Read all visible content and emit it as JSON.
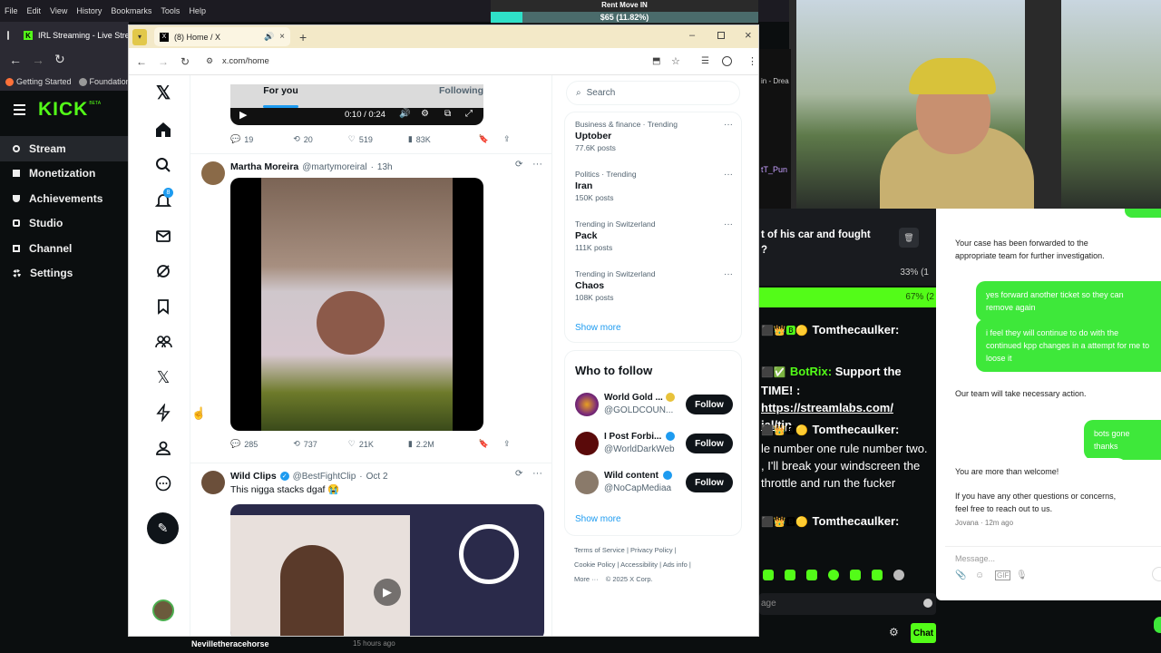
{
  "outer_browser": {
    "menu": [
      "File",
      "Edit",
      "View",
      "History",
      "Bookmarks",
      "Tools",
      "Help"
    ],
    "tab_title": "IRL Streaming - Live Stre",
    "bookmarks": [
      "Getting Started",
      "Foundation"
    ]
  },
  "overlay": {
    "title": "Rent Move IN",
    "amount": "$65 (11.82%)"
  },
  "kick": {
    "logo": "KICK",
    "beta": "BETA",
    "nav": [
      {
        "label": "Stream",
        "icon": "stream-icon"
      },
      {
        "label": "Monetization",
        "icon": "monetization-icon"
      },
      {
        "label": "Achievements",
        "icon": "trophy-icon"
      },
      {
        "label": "Studio",
        "icon": "studio-icon"
      },
      {
        "label": "Channel",
        "icon": "channel-icon"
      },
      {
        "label": "Settings",
        "icon": "gear-icon"
      }
    ]
  },
  "x_window": {
    "tab_title": "(8) Home / X",
    "url": "x.com/home",
    "feed_tabs": {
      "for_you": "For you",
      "following": "Following"
    },
    "video_time": "0:10 / 0:24",
    "search_placeholder": "Search",
    "notification_count": "8",
    "tweets": [
      {
        "replies": "19",
        "retweets": "20",
        "likes": "519",
        "views": "83K"
      },
      {
        "name": "Martha Moreira",
        "handle": "@martymoreiral",
        "time": "13h",
        "replies": "285",
        "retweets": "737",
        "likes": "21K",
        "views": "2.2M"
      },
      {
        "name": "Wild Clips",
        "handle": "@BestFightClip",
        "time": "Oct 2",
        "text": "This nigga stacks dgaf 😭"
      }
    ],
    "trends": [
      {
        "context": "Business & finance · Trending",
        "title": "Uptober",
        "posts": "77.6K posts"
      },
      {
        "context": "Politics · Trending",
        "title": "Iran",
        "posts": "150K posts"
      },
      {
        "context": "Trending in Switzerland",
        "title": "Pack",
        "posts": "111K posts"
      },
      {
        "context": "Trending in Switzerland",
        "title": "Chaos",
        "posts": "108K posts"
      }
    ],
    "show_more": "Show more",
    "who_to_follow_title": "Who to follow",
    "follow_suggestions": [
      {
        "name": "World Gold ...",
        "handle": "@GOLDCOUN..."
      },
      {
        "name": "I Post Forbi...",
        "handle": "@WorldDarkWeb"
      },
      {
        "name": "Wild content",
        "handle": "@NoCapMediaa"
      }
    ],
    "follow_label": "Follow",
    "footer": [
      "Terms of Service",
      "Privacy Policy",
      "Cookie Policy",
      "Accessibility",
      "Ads info",
      "More ···",
      "© 2025 X Corp."
    ],
    "bottom_strip_name": "Nevilletheracehorse",
    "bottom_strip_time": "15 hours ago"
  },
  "chat": {
    "partial_top": "t of his car and fought",
    "partial_top2": "?",
    "poll_a": "33% (1",
    "poll_b": "67% (2",
    "messages": [
      {
        "user": "Tomthecaulker:",
        "text": ""
      },
      {
        "user": "BotRix:",
        "text": " Support the TIME! : ",
        "link": "https://streamlabs.com/",
        "link2": "ial/tip"
      },
      {
        "user": "Tomthecaulker:",
        "text": "le number one rule number two. , I'll break your windscreen the throttle and run the fucker"
      },
      {
        "user": "Tomthecaulker:",
        "text": ""
      }
    ],
    "input_placeholder": "age",
    "chat_button": "Chat"
  },
  "sms": {
    "in1": "Your case has been forwarded to the appropriate team for further investigation.",
    "out1": "yes forward another ticket so they can remove again",
    "out2": "i feel they will continue to do with the continued kpp changes in a attempt for me to loose it",
    "in2": "Our team will take necessary action.",
    "out3": "bots gone thanks",
    "in3a": "You are more than welcome!",
    "in3b": "If you have any other questions or concerns, feel free to reach out to us.",
    "sender": "Jovana · 12m ago",
    "input_placeholder": "Message..."
  },
  "colors": {
    "kick_green": "#53fc18",
    "x_blue": "#1d9bf0",
    "sms_green": "#3ee83a"
  }
}
